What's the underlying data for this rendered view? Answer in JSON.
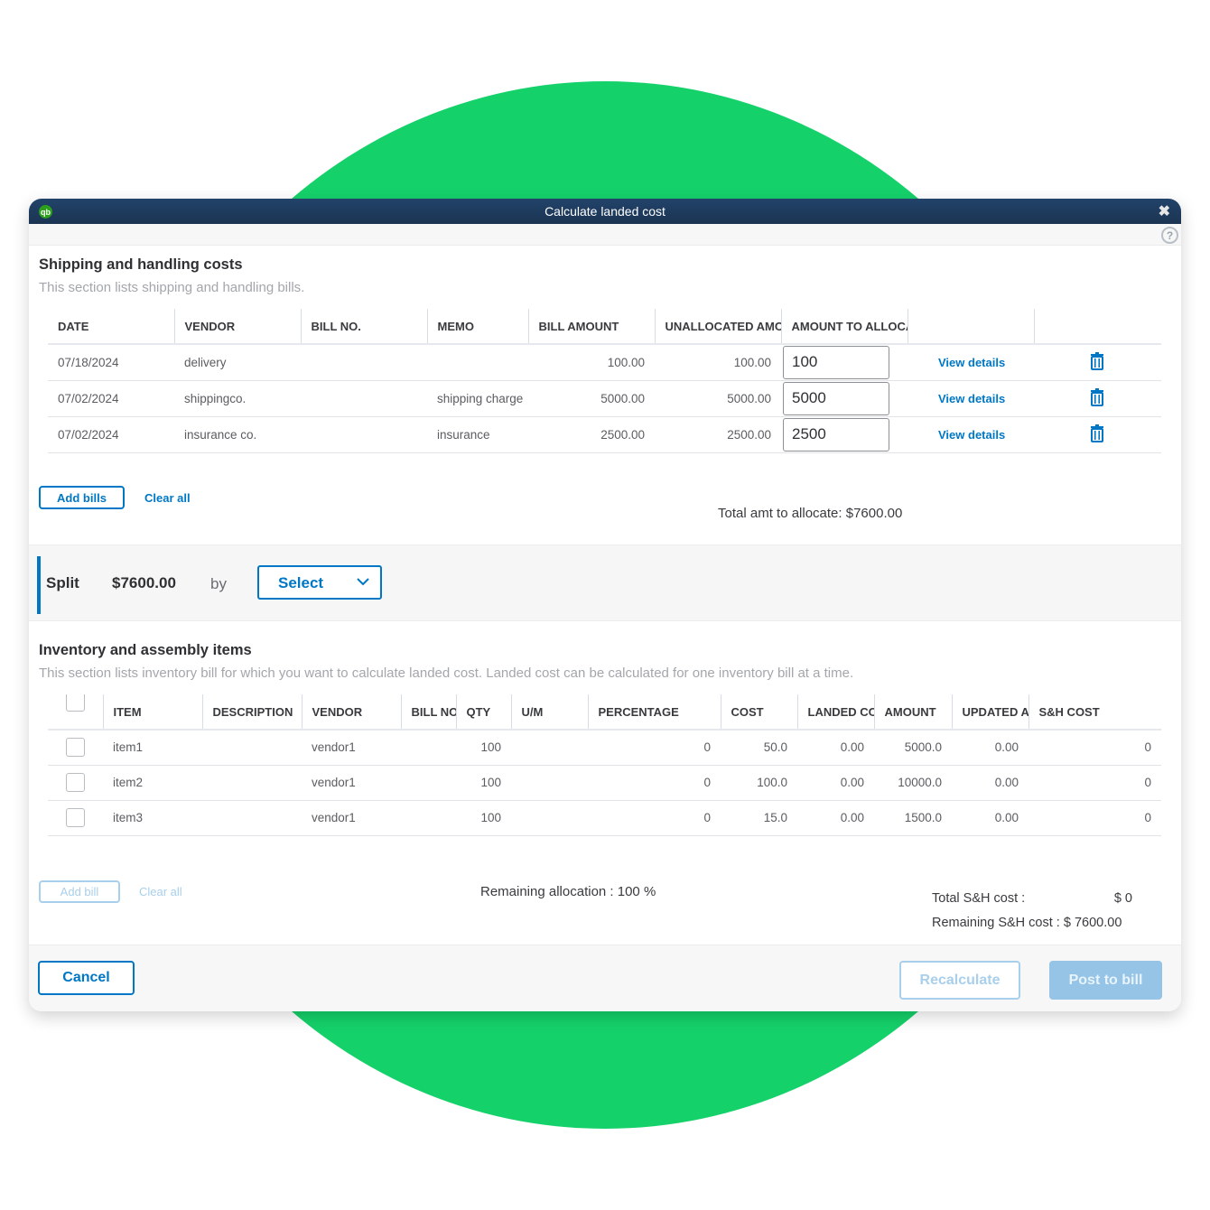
{
  "window": {
    "title": "Calculate landed cost",
    "logo_text": "qb",
    "close_glyph": "✖",
    "help_glyph": "?"
  },
  "shipping": {
    "title": "Shipping and handling costs",
    "subtitle": "This section lists shipping and handling bills.",
    "columns": [
      "DATE",
      "VENDOR",
      "BILL NO.",
      "MEMO",
      "BILL AMOUNT",
      "UNALLOCATED AMOUNT",
      "AMOUNT TO ALLOCATE",
      "",
      ""
    ],
    "rows": [
      {
        "date": "07/18/2024",
        "vendor": "delivery",
        "bill_no": "",
        "memo": "",
        "bill_amount": "100.00",
        "unallocated": "100.00",
        "amount_to_allocate": "100",
        "link": "View details"
      },
      {
        "date": "07/02/2024",
        "vendor": "shippingco.",
        "bill_no": "",
        "memo": "shipping charge",
        "bill_amount": "5000.00",
        "unallocated": "5000.00",
        "amount_to_allocate": "5000",
        "link": "View details"
      },
      {
        "date": "07/02/2024",
        "vendor": "insurance co.",
        "bill_no": "",
        "memo": "insurance",
        "bill_amount": "2500.00",
        "unallocated": "2500.00",
        "amount_to_allocate": "2500",
        "link": "View details"
      }
    ],
    "add_bills_label": "Add bills",
    "clear_all_label": "Clear all",
    "total_label": "Total amt to allocate: $7600.00"
  },
  "split": {
    "label": "Split",
    "amount": "$7600.00",
    "by_label": "by",
    "select_value": "Select"
  },
  "inventory": {
    "title": "Inventory and assembly items",
    "subtitle": "This section lists inventory bill for which you want to calculate landed cost. Landed cost can be calculated for one inventory bill at a time.",
    "columns": [
      "",
      "ITEM",
      "DESCRIPTION",
      "VENDOR",
      "BILL NO",
      "QTY",
      "U/M",
      "PERCENTAGE",
      "COST",
      "LANDED COST",
      "AMOUNT",
      "UPDATED AMOUNT",
      "S&H COST"
    ],
    "rows": [
      {
        "checked": false,
        "item": "item1",
        "description": "",
        "vendor": "vendor1",
        "bill_no": "",
        "qty": "100",
        "um": "",
        "percentage": "0",
        "cost": "50.0",
        "landed_cost": "0.00",
        "amount": "5000.0",
        "updated_amount": "0.00",
        "sh_cost": "0"
      },
      {
        "checked": false,
        "item": "item2",
        "description": "",
        "vendor": "vendor1",
        "bill_no": "",
        "qty": "100",
        "um": "",
        "percentage": "0",
        "cost": "100.0",
        "landed_cost": "0.00",
        "amount": "10000.0",
        "updated_amount": "0.00",
        "sh_cost": "0"
      },
      {
        "checked": false,
        "item": "item3",
        "description": "",
        "vendor": "vendor1",
        "bill_no": "",
        "qty": "100",
        "um": "",
        "percentage": "0",
        "cost": "15.0",
        "landed_cost": "0.00",
        "amount": "1500.0",
        "updated_amount": "0.00",
        "sh_cost": "0"
      }
    ],
    "add_bill_label": "Add bill",
    "clear_all_label": "Clear all",
    "remaining_allocation": "Remaining allocation : 100 %",
    "total_sh_label": "Total S&H cost :",
    "total_sh_value": "$ 0",
    "remaining_sh_label": "Remaining S&H cost :",
    "remaining_sh_value": "$ 7600.00"
  },
  "footer": {
    "cancel_label": "Cancel",
    "recalculate_label": "Recalculate",
    "post_label": "Post to bill"
  },
  "colors": {
    "accent": "#0077c5",
    "titlebar": "#1f3c5e",
    "background_circle": "#15d16a",
    "disabled_button": "#95c4e6"
  }
}
